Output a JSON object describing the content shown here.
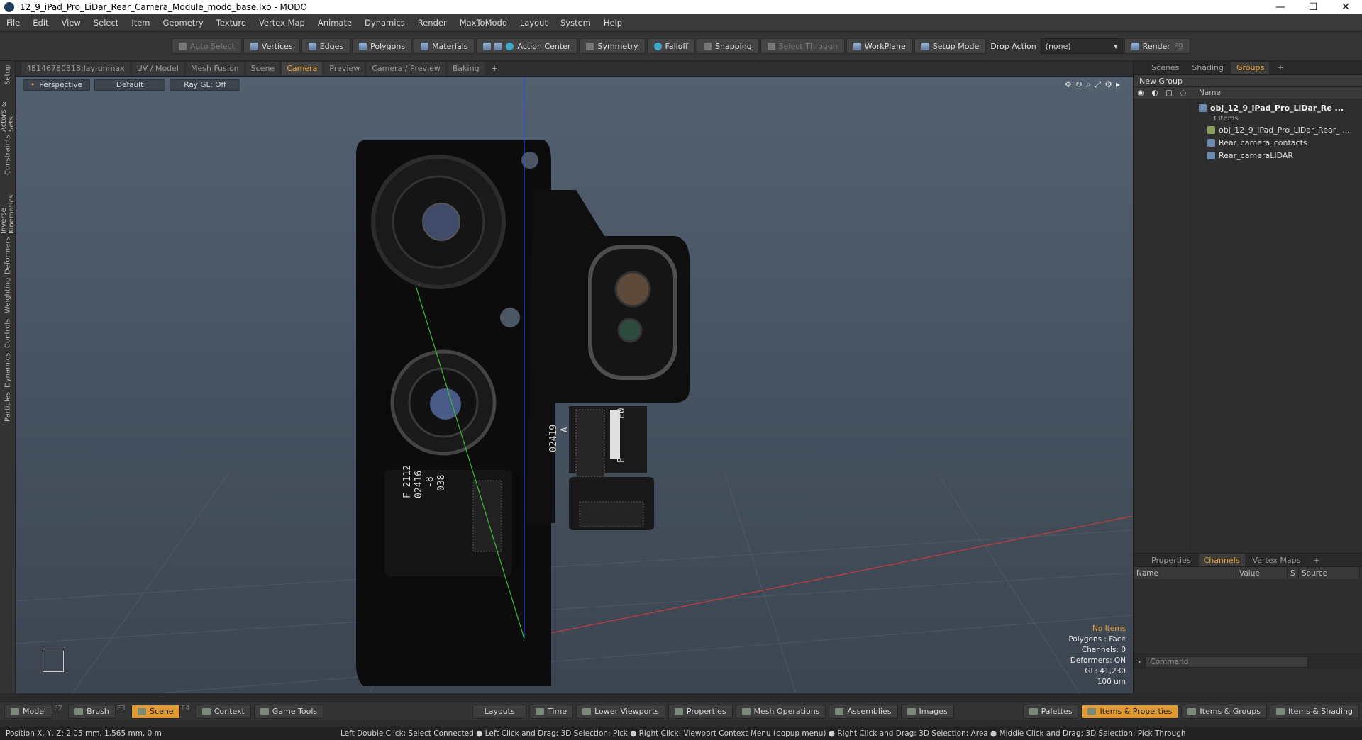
{
  "window": {
    "title": "12_9_iPad_Pro_LiDar_Rear_Camera_Module_modo_base.lxo - MODO",
    "minimize": "—",
    "maximize": "☐",
    "close": "✕"
  },
  "menu": [
    "File",
    "Edit",
    "View",
    "Select",
    "Item",
    "Geometry",
    "Texture",
    "Vertex Map",
    "Animate",
    "Dynamics",
    "Render",
    "MaxToModo",
    "Layout",
    "System",
    "Help"
  ],
  "toolbar": {
    "auto_select": "Auto Select",
    "vertices": "Vertices",
    "edges": "Edges",
    "polygons": "Polygons",
    "materials": "Materials",
    "action_center": "Action Center",
    "symmetry": "Symmetry",
    "falloff": "Falloff",
    "snapping": "Snapping",
    "select_through": "Select Through",
    "workplane": "WorkPlane",
    "setup_mode": "Setup Mode",
    "drop_action": "Drop Action",
    "drop_action_value": "(none)",
    "render": "Render",
    "render_key": "F9"
  },
  "left_tabs": [
    "Setup",
    "Actors & Sets",
    "Constraints",
    "Inverse Kinematics",
    "Deformers",
    "Weighting",
    "Controls",
    "Dynamics",
    "Particles"
  ],
  "view_tabs": [
    "48146780318:lay-unmax",
    "UV / Model",
    "Mesh Fusion",
    "Scene",
    "Camera",
    "Preview",
    "Camera / Preview",
    "Baking",
    "+"
  ],
  "viewport": {
    "projection": "Perspective",
    "shading": "Default",
    "raygl": "Ray GL: Off",
    "info_no_items": "No Items",
    "info_polygons": "Polygons : Face",
    "info_channels": "Channels: 0",
    "info_deformers": "Deformers: ON",
    "info_gl": "GL: 41,230",
    "info_scale": "100 um",
    "label_left_1": "F 2112",
    "label_left_2": "02416",
    "label_left_3": "-8",
    "label_left_4": "038",
    "label_right_1": "02419",
    "label_right_2": "-A",
    "label_right_3": "E0",
    "label_right_4": "E"
  },
  "right_panel": {
    "tabs": [
      "Scenes",
      "Shading",
      "Groups",
      "+"
    ],
    "new_group": "New Group",
    "name_header": "Name",
    "items": [
      {
        "label": "obj_12_9_iPad_Pro_LiDar_Re ..."
      },
      {
        "label": "3 Items"
      },
      {
        "label": "obj_12_9_iPad_Pro_LiDar_Rear_ ..."
      },
      {
        "label": "Rear_camera_contacts"
      },
      {
        "label": "Rear_cameraLIDAR"
      }
    ],
    "channel_tabs": [
      "Properties",
      "Channels",
      "Vertex Maps",
      "+"
    ],
    "channel_cols": [
      "Name",
      "Value",
      "S",
      "Source"
    ],
    "command_placeholder": "Command"
  },
  "bottom_bar": {
    "model": "Model",
    "model_key": "F2",
    "brush": "Brush",
    "brush_key": "F3",
    "scene": "Scene",
    "scene_key": "F4",
    "context": "Context",
    "game_tools": "Game Tools",
    "layouts": "Layouts",
    "time": "Time",
    "lower_viewports": "Lower Viewports",
    "properties": "Properties",
    "mesh_operations": "Mesh Operations",
    "assemblies": "Assemblies",
    "images": "Images",
    "palettes": "Palettes",
    "items_properties": "Items & Properties",
    "items_groups": "Items & Groups",
    "items_shading": "Items & Shading"
  },
  "status": {
    "position": "Position X, Y, Z:   2.05 mm, 1.565 mm, 0 m",
    "hints": "Left Double Click: Select Connected ● Left Click and Drag: 3D Selection: Pick ● Right Click: Viewport Context Menu (popup menu) ● Right Click and Drag: 3D Selection: Area ● Middle Click and Drag: 3D Selection: Pick Through"
  },
  "colors": {
    "accent": "#f0a030",
    "viewport_bg": "#4b5664",
    "panel_bg": "#2d2d2d"
  }
}
